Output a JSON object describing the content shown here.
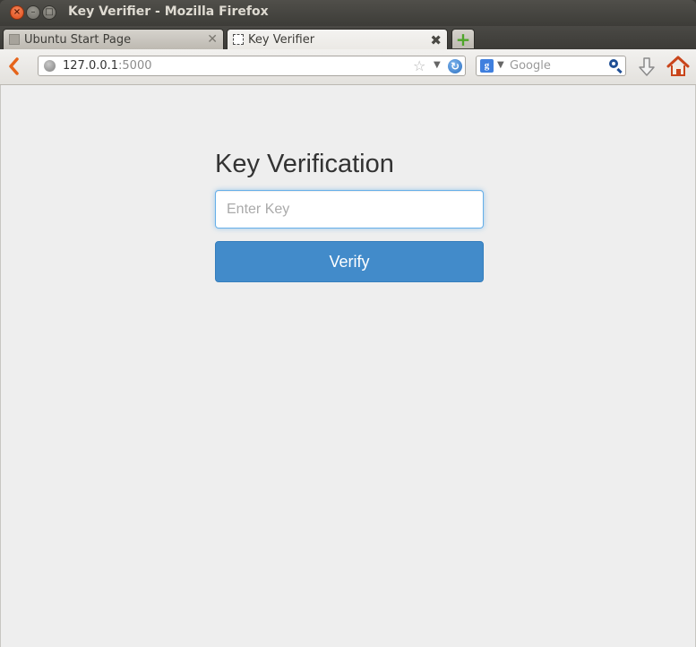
{
  "window": {
    "title": "Key Verifier - Mozilla Firefox"
  },
  "tabs": [
    {
      "label": "Ubuntu Start Page",
      "active": false
    },
    {
      "label": "Key Verifier",
      "active": true
    }
  ],
  "navbar": {
    "url_host": "127.0.0.1",
    "url_port": ":5000",
    "search_placeholder": "Google"
  },
  "page": {
    "heading": "Key Verification",
    "key_placeholder": "Enter Key",
    "verify_label": "Verify"
  },
  "colors": {
    "accent": "#428bca",
    "titlebar": "#3c3b37",
    "page_background": "#eeeeee"
  }
}
